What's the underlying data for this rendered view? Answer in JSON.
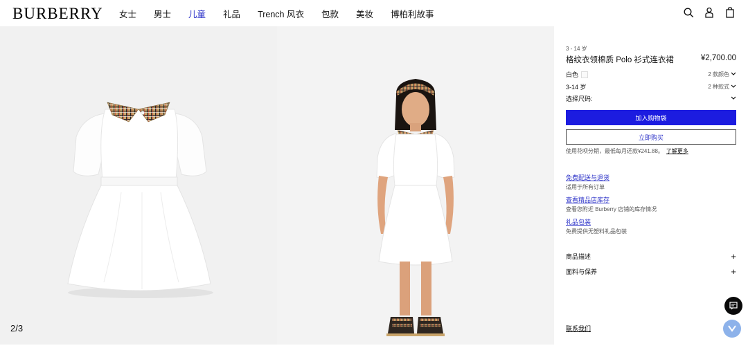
{
  "header": {
    "logo": "BURBERRY",
    "nav": [
      "女士",
      "男士",
      "儿童",
      "礼品",
      "Trench 风衣",
      "包款",
      "美妆",
      "博柏利故事"
    ],
    "active_nav_index": 2,
    "icons": [
      "search-icon",
      "account-icon",
      "shopping-bag-icon"
    ]
  },
  "gallery": {
    "counter": "2/3"
  },
  "product": {
    "age_range": "3 - 14 岁",
    "title": "格纹衣领棉质 Polo 衫式连衣裙",
    "price": "¥2,700.00",
    "color_label": "白色",
    "color_options": "2 款颜色",
    "size_range_label": "3-14 岁",
    "style_options": "2 种款式",
    "size_select": "选择尺码:",
    "add_to_bag": "加入购物袋",
    "buy_now": "立即购买",
    "installment_text": "使用花呗分期，最低每月还款¥241.88。",
    "learn_more": "了解更多"
  },
  "services": [
    {
      "title": "免费配送与退货",
      "desc": "适用于所有订单"
    },
    {
      "title": "查看精品店库存",
      "desc": "查看您附近 Burberry 店铺的库存情况"
    },
    {
      "title": "礼品包装",
      "desc": "免费提供无塑料礼品包装"
    }
  ],
  "accordions": [
    "商品描述",
    "面料与保养"
  ],
  "contact": "联系我们",
  "colors": {
    "accent": "#1c1ce0",
    "link": "#2f35c9",
    "active_nav": "#2f35c9"
  }
}
